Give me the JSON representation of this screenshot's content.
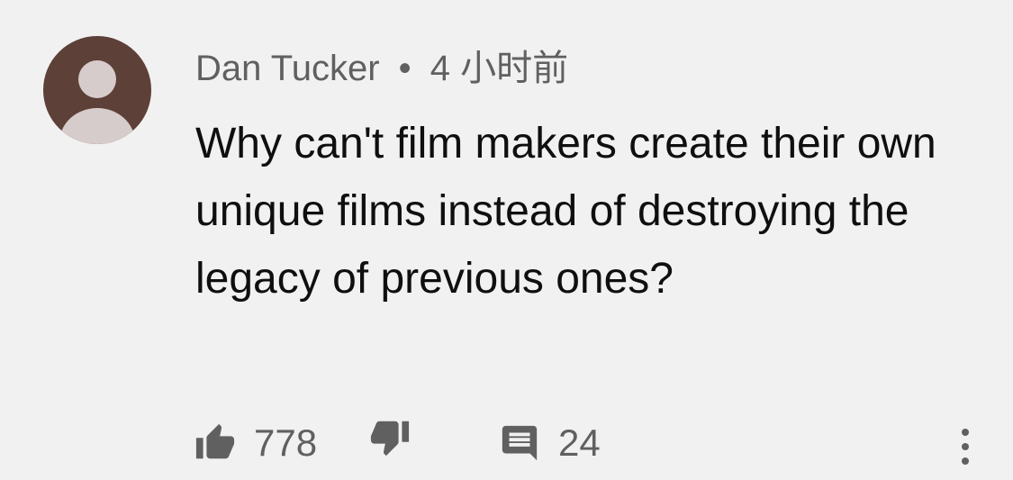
{
  "comment": {
    "author": "Dan Tucker",
    "separator": "•",
    "time": "4 小时前",
    "text": "Why can't film makers create their own unique films instead of destroying the legacy of previous ones?",
    "like_count": "778",
    "reply_count": "24"
  },
  "icons": {
    "avatar": "default-avatar-icon",
    "like": "thumbs-up-icon",
    "dislike": "thumbs-down-icon",
    "reply": "comment-icon",
    "more": "more-vertical-icon"
  },
  "colors": {
    "background": "#f1f1f1",
    "avatar_bg": "#5d4037",
    "avatar_fg": "#d7cccc",
    "secondary_text": "#606060",
    "primary_text": "#0f0f0f"
  }
}
